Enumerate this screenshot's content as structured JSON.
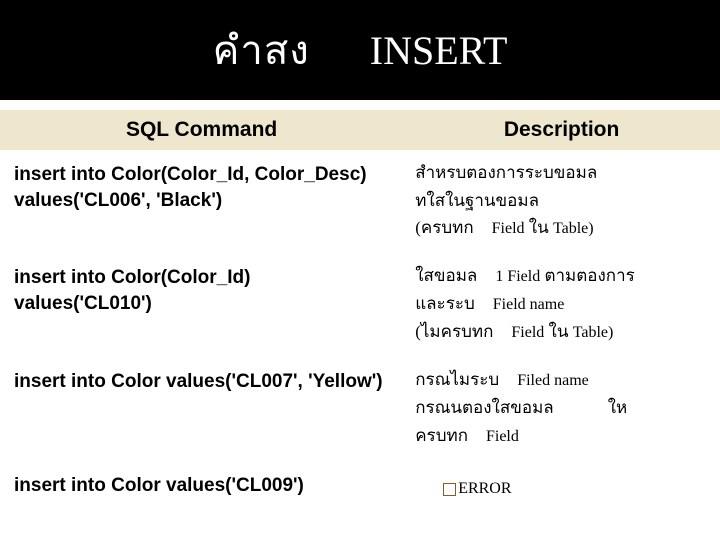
{
  "title": {
    "thai": "คําสง",
    "en": "INSERT"
  },
  "headers": {
    "left": "SQL Command",
    "right": "Description"
  },
  "rows": [
    {
      "sql": "insert into Color(Color_Id, Color_Desc) values('CL006', 'Black')",
      "desc_lines": [
        {
          "parts": [
            {
              "t": "สำหรบตองการระบขอมล",
              "latin": false
            }
          ]
        },
        {
          "parts": [
            {
              "t": "ทใสในฐานขอมล",
              "latin": false
            }
          ]
        },
        {
          "parts": [
            {
              "t": "(ครบทก",
              "latin": false
            },
            {
              "gap": "gap8"
            },
            {
              "t": "Field",
              "latin": true
            },
            {
              "t": " ใน ",
              "latin": false
            },
            {
              "t": "Table)",
              "latin": true
            }
          ]
        }
      ]
    },
    {
      "sql": "insert into Color(Color_Id) values('CL010')",
      "desc_lines": [
        {
          "parts": [
            {
              "t": "ใสขอมล",
              "latin": false
            },
            {
              "gap": "gap8"
            },
            {
              "t": "1 Field",
              "latin": true
            },
            {
              "t": " ตามตองการ",
              "latin": false
            }
          ]
        },
        {
          "parts": [
            {
              "t": "และระบ",
              "latin": false
            },
            {
              "gap": "gap8"
            },
            {
              "t": "Field name",
              "latin": true
            }
          ]
        },
        {
          "parts": [
            {
              "t": "(ไมครบทก",
              "latin": false
            },
            {
              "gap": "gap8"
            },
            {
              "t": "Field",
              "latin": true
            },
            {
              "t": " ใน ",
              "latin": false
            },
            {
              "t": "Table)",
              "latin": true
            }
          ]
        }
      ]
    },
    {
      "sql": "insert into Color values('CL007', 'Yellow')",
      "desc_lines": [
        {
          "parts": [
            {
              "t": "กรณไมระบ",
              "latin": false
            },
            {
              "gap": "gap8"
            },
            {
              "t": "Filed name",
              "latin": true
            }
          ]
        },
        {
          "parts": [
            {
              "t": "กรณนตองใสขอมล",
              "latin": false
            },
            {
              "gap": "gap8"
            },
            {
              "gap": "gap8"
            },
            {
              "gap": "gap8"
            },
            {
              "t": "ให",
              "latin": false
            }
          ]
        },
        {
          "parts": [
            {
              "t": "ครบทก",
              "latin": false
            },
            {
              "gap": "gap8"
            },
            {
              "t": "Field",
              "latin": true
            }
          ]
        }
      ]
    },
    {
      "sql": "insert into Color values('CL009')",
      "error": "ERROR"
    }
  ]
}
